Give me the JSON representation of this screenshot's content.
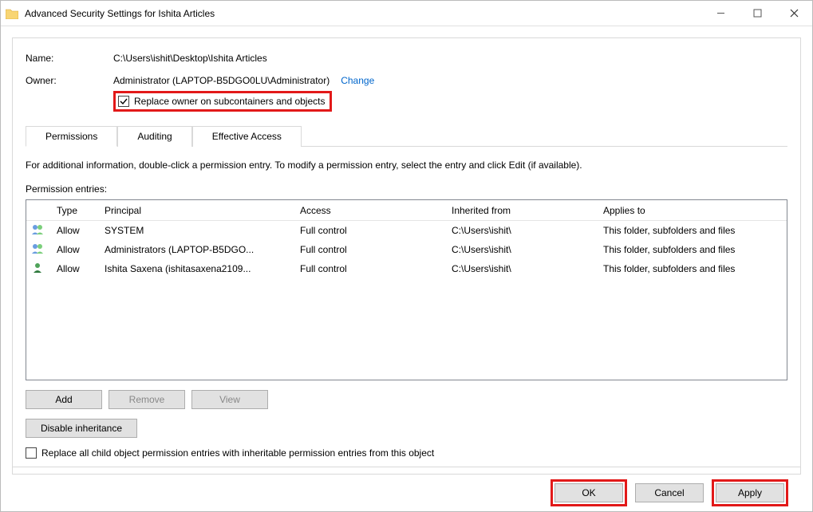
{
  "window": {
    "title": "Advanced Security Settings for Ishita Articles"
  },
  "fields": {
    "name_label": "Name:",
    "name": "C:\\Users\\ishit\\Desktop\\Ishita Articles",
    "owner_label": "Owner:",
    "owner": "Administrator (LAPTOP-B5DGO0LU\\Administrator)",
    "change_link": "Change",
    "replace_owner_checkbox": "Replace owner on subcontainers and objects"
  },
  "tabs": {
    "permissions": "Permissions",
    "auditing": "Auditing",
    "effective": "Effective Access"
  },
  "body": {
    "info": "For additional information, double-click a permission entry. To modify a permission entry, select the entry and click Edit (if available).",
    "entries_label": "Permission entries:"
  },
  "columns": {
    "type": "Type",
    "principal": "Principal",
    "access": "Access",
    "inherited": "Inherited from",
    "applies": "Applies to"
  },
  "rows": [
    {
      "type": "Allow",
      "principal": "SYSTEM",
      "access": "Full control",
      "inherited": "C:\\Users\\ishit\\",
      "applies": "This folder, subfolders and files",
      "icon": "group"
    },
    {
      "type": "Allow",
      "principal": "Administrators (LAPTOP-B5DGO...",
      "access": "Full control",
      "inherited": "C:\\Users\\ishit\\",
      "applies": "This folder, subfolders and files",
      "icon": "group"
    },
    {
      "type": "Allow",
      "principal": "Ishita Saxena (ishitasaxena2109...",
      "access": "Full control",
      "inherited": "C:\\Users\\ishit\\",
      "applies": "This folder, subfolders and files",
      "icon": "user"
    }
  ],
  "buttons": {
    "add": "Add",
    "remove": "Remove",
    "view": "View",
    "disable": "Disable inheritance",
    "replace_child": "Replace all child object permission entries with inheritable permission entries from this object"
  },
  "footer": {
    "ok": "OK",
    "cancel": "Cancel",
    "apply": "Apply"
  }
}
